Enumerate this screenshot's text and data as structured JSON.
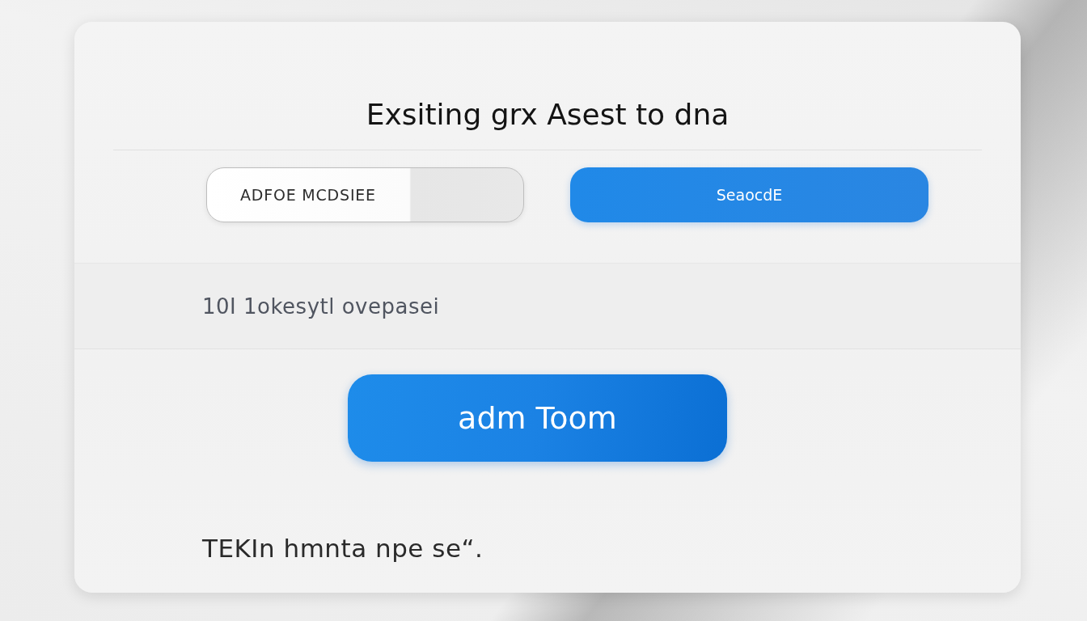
{
  "title": "Exsiting grx Asest to dna",
  "form": {
    "field": {
      "value": "ADFOE MCDSIEE"
    },
    "button": "SeaocdE"
  },
  "info": "10I 1okesytl ovepasei",
  "primary_button": "adm Toom",
  "footer": "TEKIn hmnta npe se“."
}
